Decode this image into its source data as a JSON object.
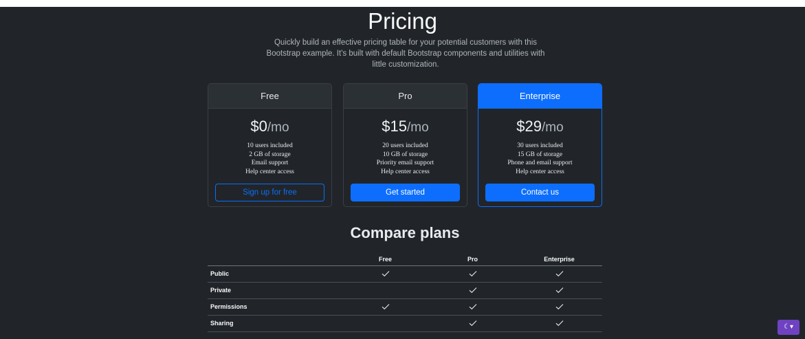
{
  "header": {
    "title": "Pricing",
    "lead": "Quickly build an effective pricing table for your potential customers with this Bootstrap example. It's built with default Bootstrap components and utilities with little customization."
  },
  "plans": [
    {
      "name": "Free",
      "price": "$0",
      "per": "/mo",
      "features": [
        "10 users included",
        "2 GB of storage",
        "Email support",
        "Help center access"
      ],
      "button": "Sign up for free"
    },
    {
      "name": "Pro",
      "price": "$15",
      "per": "/mo",
      "features": [
        "20 users included",
        "10 GB of storage",
        "Priority email support",
        "Help center access"
      ],
      "button": "Get started"
    },
    {
      "name": "Enterprise",
      "price": "$29",
      "per": "/mo",
      "features": [
        "30 users included",
        "15 GB of storage",
        "Phone and email support",
        "Help center access"
      ],
      "button": "Contact us"
    }
  ],
  "compare": {
    "title": "Compare plans",
    "columns": [
      "",
      "Free",
      "Pro",
      "Enterprise"
    ],
    "rows": [
      {
        "label": "Public",
        "free": true,
        "pro": true,
        "enterprise": true
      },
      {
        "label": "Private",
        "free": false,
        "pro": true,
        "enterprise": true
      },
      {
        "label": "Permissions",
        "free": true,
        "pro": true,
        "enterprise": true
      },
      {
        "label": "Sharing",
        "free": false,
        "pro": true,
        "enterprise": true
      }
    ]
  },
  "colors": {
    "background": "#212529",
    "accent": "#0d6efd",
    "theme_toggle": "#6f42c1"
  },
  "icons": {
    "check": "check-icon",
    "theme_toggle": "moon-icon"
  }
}
